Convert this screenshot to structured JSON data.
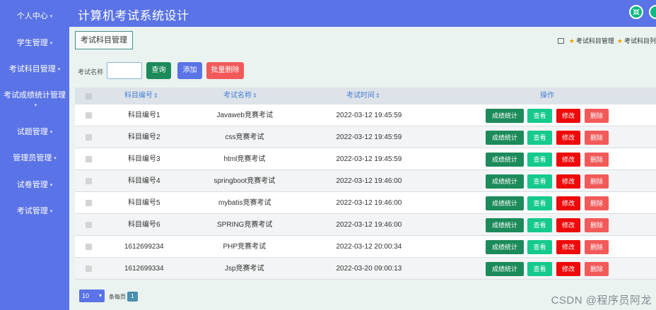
{
  "app": {
    "title": "计算机考试系统设计"
  },
  "sidebar": {
    "items": [
      {
        "label": "个人中心"
      },
      {
        "label": "学生管理"
      },
      {
        "label": "考试科目管理"
      },
      {
        "label": "考试成绩统计管理"
      },
      {
        "label": "试题管理"
      },
      {
        "label": "管理员管理"
      },
      {
        "label": "试卷管理"
      },
      {
        "label": "考试管理"
      }
    ],
    "caret": "▾"
  },
  "header": {
    "icon_left": "shrink-arrows-icon",
    "icon_right": "user-icon"
  },
  "tab": {
    "label": "考试科目管理"
  },
  "breadcrumb": {
    "item1": "考试科目管理",
    "item2": "考试科目列"
  },
  "search": {
    "label": "考试名称",
    "value": "",
    "query_label": "查询",
    "add_label": "添加",
    "batch_delete_label": "批量删除"
  },
  "table": {
    "headers": {
      "code": "科目编号",
      "name": "考试名称",
      "time": "考试时间",
      "ops": "操作",
      "sort": "⇕"
    },
    "rows": [
      {
        "code": "科目编号1",
        "name": "Javaweb竞赛考试",
        "time": "2022-03-12 19:45:59"
      },
      {
        "code": "科目编号2",
        "name": "css竞赛考试",
        "time": "2022-03-12 19:45:59"
      },
      {
        "code": "科目编号3",
        "name": "html竞赛考试",
        "time": "2022-03-12 19:45:59"
      },
      {
        "code": "科目编号4",
        "name": "springboot竞赛考试",
        "time": "2022-03-12 19:46:00"
      },
      {
        "code": "科目编号5",
        "name": "mybatis竞赛考试",
        "time": "2022-03-12 19:46:00"
      },
      {
        "code": "科目编号6",
        "name": "SPRING竞赛考试",
        "time": "2022-03-12 19:46:00"
      },
      {
        "code": "1612699234",
        "name": "PHP竞赛考试",
        "time": "2022-03-12 20:00:34"
      },
      {
        "code": "1612699334",
        "name": "Jsp竞赛考试",
        "time": "2022-03-20 09:00:13"
      }
    ],
    "ops": {
      "stats": "成绩统计",
      "view": "查看",
      "edit": "修改",
      "delete": "删除"
    }
  },
  "pagination": {
    "page_size": "10",
    "per_page_label": "条每页",
    "current_page": "1"
  },
  "watermark": "CSDN @程序员阿龙",
  "colors": {
    "primary": "#5a73e6",
    "success": "#1c8a5a",
    "view": "#16c98d",
    "danger": "#ee0a0a",
    "danger_light": "#f25a5a",
    "background": "#eaf3ef"
  }
}
